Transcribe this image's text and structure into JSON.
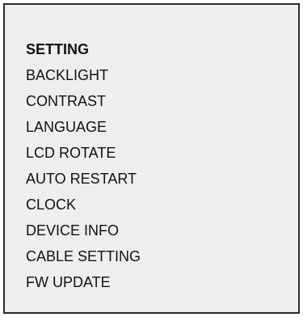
{
  "menu": {
    "title": "SETTING",
    "items": [
      {
        "label": "BACKLIGHT"
      },
      {
        "label": "CONTRAST"
      },
      {
        "label": "LANGUAGE"
      },
      {
        "label": "LCD ROTATE"
      },
      {
        "label": "AUTO RESTART"
      },
      {
        "label": "CLOCK"
      },
      {
        "label": "DEVICE INFO"
      },
      {
        "label": "CABLE SETTING"
      },
      {
        "label": "FW UPDATE"
      }
    ]
  }
}
